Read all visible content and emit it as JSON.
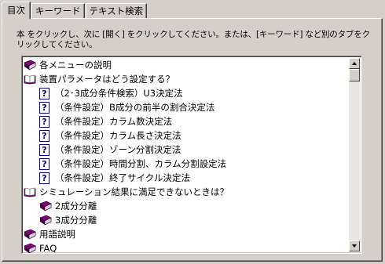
{
  "tabs": [
    {
      "label": "目次",
      "active": true
    },
    {
      "label": "キーワード",
      "active": false
    },
    {
      "label": "テキスト検索",
      "active": false
    }
  ],
  "instructions": "本 をクリックし、次に [開く] をクリックしてください。または、[キーワード] など別のタブをクリックしてください。",
  "tree": [
    {
      "label": "各メニューの説明",
      "icon": "closed-book-icon",
      "level": 0
    },
    {
      "label": "装置パラメータはどう設定する？",
      "icon": "open-book-icon",
      "level": 0
    },
    {
      "label": "（2･3成分条件検索）U3決定法",
      "icon": "help-topic-icon",
      "level": 1
    },
    {
      "label": "（条件設定）B成分の前半の割合決定法",
      "icon": "help-topic-icon",
      "level": 1
    },
    {
      "label": "（条件設定）カラム数決定法",
      "icon": "help-topic-icon",
      "level": 1
    },
    {
      "label": "（条件設定）カラム長さ決定法",
      "icon": "help-topic-icon",
      "level": 1
    },
    {
      "label": "（条件設定）ゾーン分割決定法",
      "icon": "help-topic-icon",
      "level": 1
    },
    {
      "label": "（条件設定）時間分割、カラム分割設定法",
      "icon": "help-topic-icon",
      "level": 1
    },
    {
      "label": "（条件設定）終了サイクル決定法",
      "icon": "help-topic-icon",
      "level": 1
    },
    {
      "label": "シミュレーション結果に満足できないときは？",
      "icon": "open-book-icon",
      "level": 0
    },
    {
      "label": "2成分分離",
      "icon": "closed-book-icon",
      "level": 1
    },
    {
      "label": "3成分分離",
      "icon": "closed-book-icon",
      "level": 1
    },
    {
      "label": "用語説明",
      "icon": "closed-book-icon",
      "level": 0
    },
    {
      "label": "FAQ",
      "icon": "closed-book-icon",
      "level": 0
    }
  ],
  "help_topic_glyph": "?",
  "colors": {
    "book": "#800080",
    "book_dark": "#400040",
    "topic_border": "#000080",
    "dialog_bg": "#d4d0c8"
  }
}
